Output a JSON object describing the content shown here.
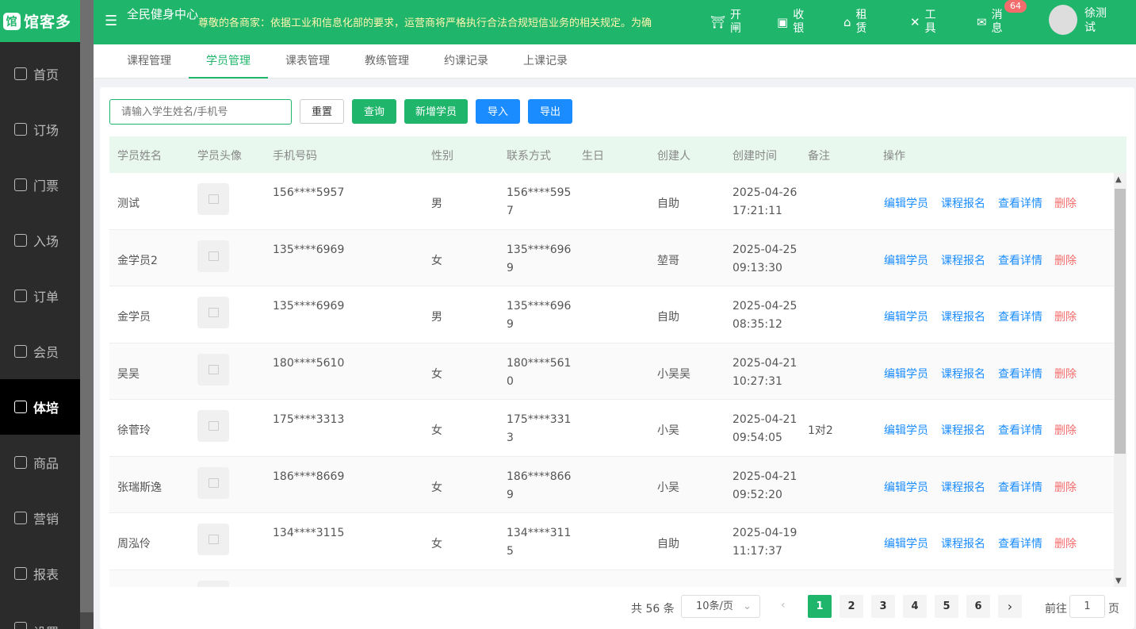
{
  "logo": {
    "icon": "馆",
    "text": "馆客多"
  },
  "sidebar": {
    "items": [
      {
        "label": "首页",
        "icon": "home-icon"
      },
      {
        "label": "订场",
        "icon": "court-icon"
      },
      {
        "label": "门票",
        "icon": "ticket-icon"
      },
      {
        "label": "入场",
        "icon": "enter-icon"
      },
      {
        "label": "订单",
        "icon": "order-icon"
      },
      {
        "label": "会员",
        "icon": "member-icon"
      },
      {
        "label": "体培",
        "icon": "training-icon",
        "active": true
      },
      {
        "label": "商品",
        "icon": "goods-icon"
      },
      {
        "label": "营销",
        "icon": "marketing-icon"
      },
      {
        "label": "报表",
        "icon": "report-icon"
      },
      {
        "label": "设置",
        "icon": "settings-icon"
      }
    ]
  },
  "header": {
    "store": "全民健身中心",
    "notice": "尊敬的各商家：依据工业和信息化部的要求，运营商将严格执行合法合规短信业务的相关规定。为确",
    "actions": [
      {
        "label": "开闸",
        "icon": "gate-icon"
      },
      {
        "label": "收银",
        "icon": "cashier-icon"
      },
      {
        "label": "租赁",
        "icon": "rent-icon"
      },
      {
        "label": "工具",
        "icon": "tools-icon"
      },
      {
        "label": "消息",
        "icon": "message-icon"
      }
    ],
    "badge": "64",
    "user": "徐测试"
  },
  "tabs": [
    "课程管理",
    "学员管理",
    "课表管理",
    "教练管理",
    "约课记录",
    "上课记录"
  ],
  "toolbar": {
    "search_placeholder": "请输入学生姓名/手机号",
    "reset": "重置",
    "query": "查询",
    "add": "新增学员",
    "import": "导入",
    "export": "导出"
  },
  "table": {
    "headers": [
      "学员姓名",
      "学员头像",
      "手机号码",
      "性别",
      "联系方式",
      "生日",
      "创建人",
      "创建时间",
      "备注",
      "操作"
    ],
    "actions": {
      "edit": "编辑学员",
      "enroll": "课程报名",
      "detail": "查看详情",
      "delete": "删除"
    },
    "rows": [
      {
        "name": "测试",
        "phone": "156****5957",
        "gender": "男",
        "contact1": "156****595",
        "contact2": "7",
        "creator": "自助",
        "date": "2025-04-26",
        "time": "17:21:11",
        "note": ""
      },
      {
        "name": "金学员2",
        "phone": "135****6969",
        "gender": "女",
        "contact1": "135****696",
        "contact2": "9",
        "creator": "堃哥",
        "date": "2025-04-25",
        "time": "09:13:30",
        "note": ""
      },
      {
        "name": "金学员",
        "phone": "135****6969",
        "gender": "男",
        "contact1": "135****696",
        "contact2": "9",
        "creator": "自助",
        "date": "2025-04-25",
        "time": "08:35:12",
        "note": ""
      },
      {
        "name": "吴吴",
        "phone": "180****5610",
        "gender": "女",
        "contact1": "180****561",
        "contact2": "0",
        "creator": "小吴吴",
        "date": "2025-04-21",
        "time": "10:27:31",
        "note": ""
      },
      {
        "name": "徐菅玲",
        "phone": "175****3313",
        "gender": "女",
        "contact1": "175****331",
        "contact2": "3",
        "creator": "小吴",
        "date": "2025-04-21",
        "time": "09:54:05",
        "note": "1对2"
      },
      {
        "name": "张瑞斯逸",
        "phone": "186****8669",
        "gender": "女",
        "contact1": "186****866",
        "contact2": "9",
        "creator": "小吴",
        "date": "2025-04-21",
        "time": "09:52:20",
        "note": ""
      },
      {
        "name": "周泓伶",
        "phone": "134****3115",
        "gender": "女",
        "contact1": "134****311",
        "contact2": "5",
        "creator": "自助",
        "date": "2025-04-19",
        "time": "11:17:37",
        "note": ""
      }
    ]
  },
  "pagination": {
    "total": "共 56 条",
    "page_size": "10条/页",
    "pages": [
      "1",
      "2",
      "3",
      "4",
      "5",
      "6"
    ],
    "current": "1",
    "goto_prefix": "前往",
    "goto_value": "1",
    "goto_suffix": "页"
  }
}
